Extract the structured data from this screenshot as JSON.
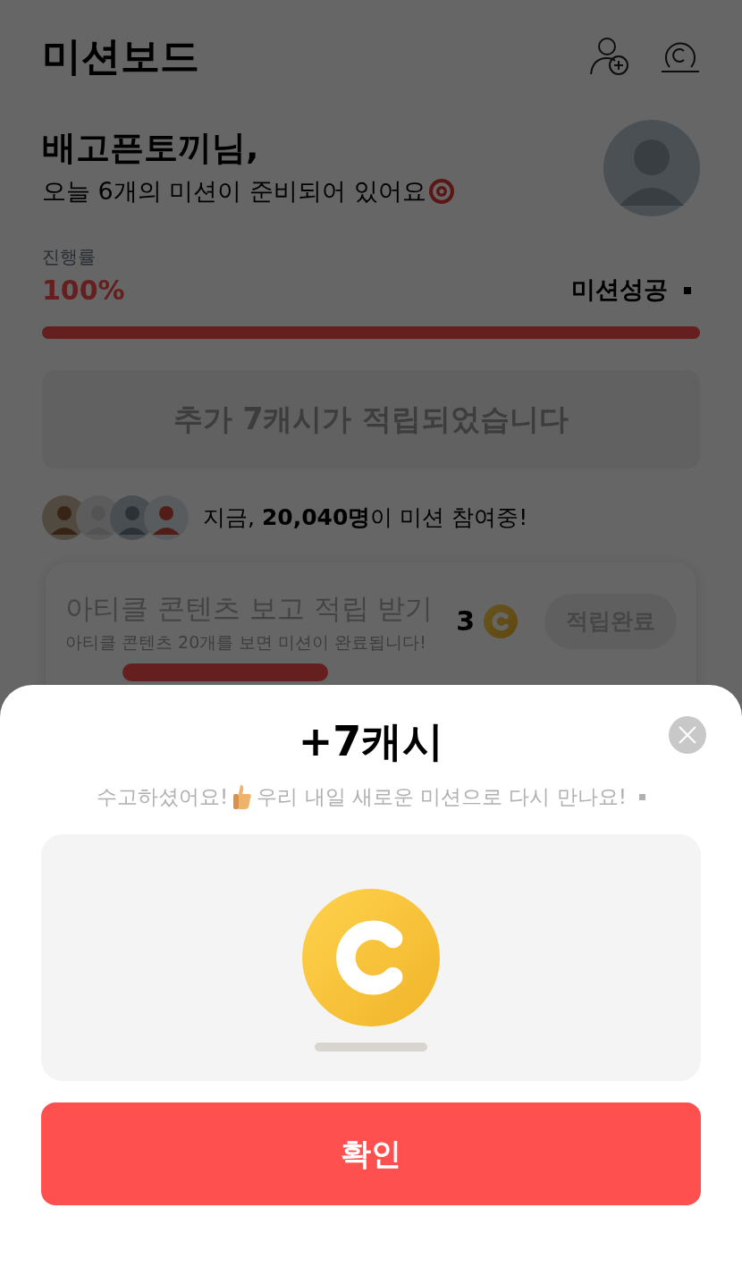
{
  "header": {
    "title": "미션보드"
  },
  "greeting": {
    "name": "배고픈토끼님,",
    "message": "오늘 6개의 미션이 준비되어 있어요"
  },
  "progress": {
    "label": "진행률",
    "percent": "100%",
    "status": "미션성공",
    "level": 1
  },
  "bonus_banner": {
    "text": "추가 7캐시가 적립되었습니다"
  },
  "participants": {
    "text": "지금, **20,040명**이 미션 참여중!"
  },
  "missions": [
    {
      "title": "아티클 콘텐츠 보고 적립 받기",
      "description": "아티클 콘텐츠 20개를 보면 미션이 완료됩니다!",
      "reward": "3",
      "button": "적립완료",
      "level": 1
    }
  ],
  "dialog": {
    "title": "+7캐시",
    "message_before": "수고하셨어요!",
    "message_after": "우리 내일 새로운 미션으로 다시 만나요!",
    "confirm": "확인"
  }
}
